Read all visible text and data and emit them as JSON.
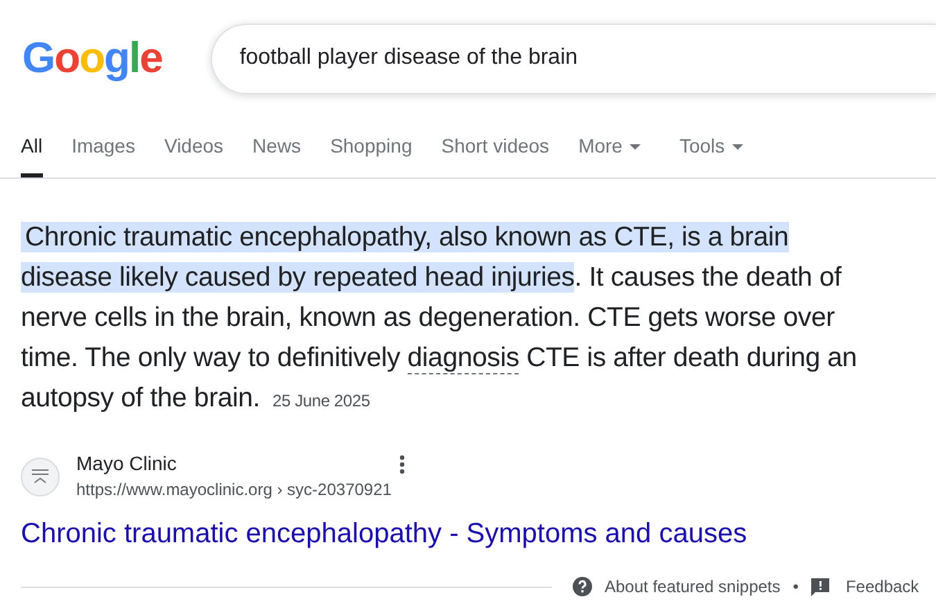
{
  "logo": "Google",
  "search": {
    "value": "football player disease of the brain"
  },
  "tabs": [
    {
      "label": "All",
      "selected": true,
      "dropdown": false
    },
    {
      "label": "Images",
      "selected": false,
      "dropdown": false
    },
    {
      "label": "Videos",
      "selected": false,
      "dropdown": false
    },
    {
      "label": "News",
      "selected": false,
      "dropdown": false
    },
    {
      "label": "Shopping",
      "selected": false,
      "dropdown": false
    },
    {
      "label": "Short videos",
      "selected": false,
      "dropdown": false
    },
    {
      "label": "More",
      "selected": false,
      "dropdown": true
    },
    {
      "label": "Tools",
      "selected": false,
      "dropdown": true
    }
  ],
  "snippet": {
    "highlight": "Chronic traumatic encephalopathy, also known as CTE, is a brain disease likely caused by repeated head injuries",
    "text_before_term": ". It causes the death of nerve cells in the brain, known as degeneration. CTE gets worse over time. The only way to definitively ",
    "term": "diagnosis",
    "text_after_term": " CTE is after death during an autopsy of the brain.",
    "date": "25 June 2025"
  },
  "source": {
    "name": "Mayo Clinic",
    "url": "https://www.mayoclinic.org › syc-20370921",
    "title": "Chronic traumatic encephalopathy - Symptoms and causes"
  },
  "footer": {
    "about": "About featured snippets",
    "separator": "•",
    "feedback": "Feedback"
  }
}
